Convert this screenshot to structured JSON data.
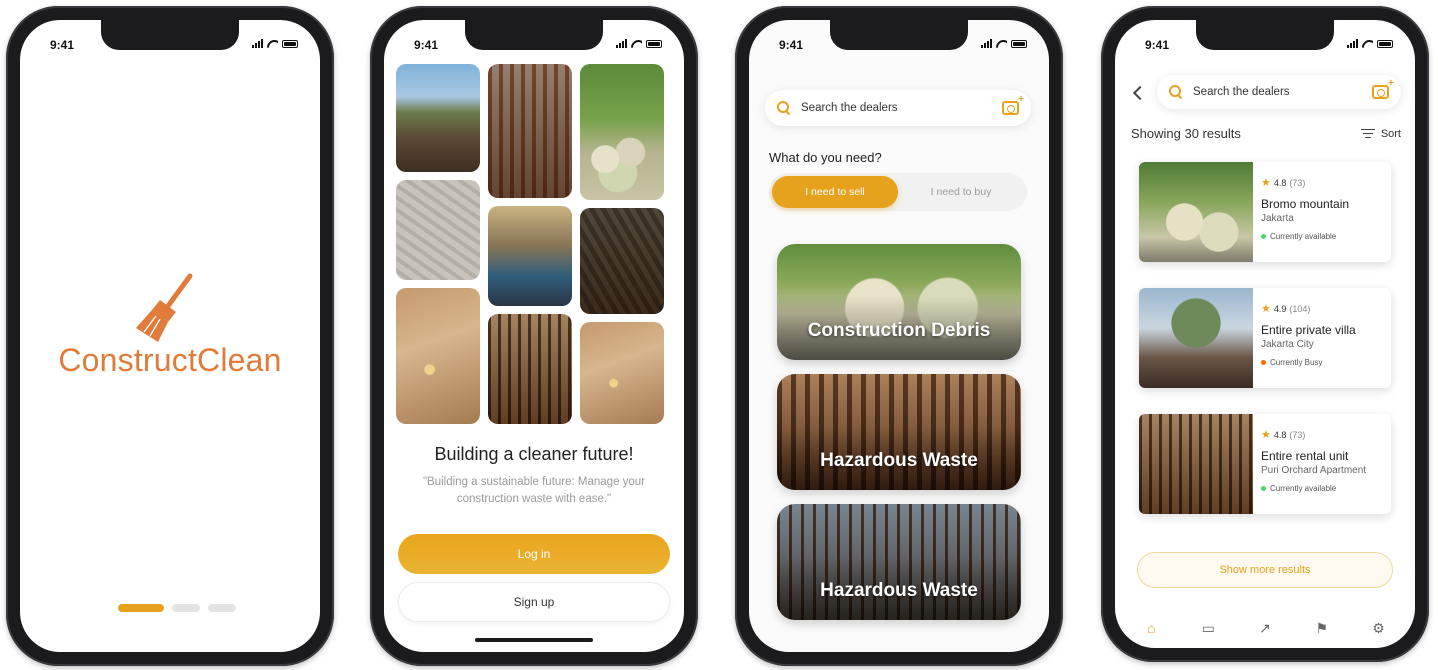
{
  "status_time": "9:41",
  "splash": {
    "brand": "ConstructClean"
  },
  "welcome": {
    "title": "Building a cleaner future!",
    "subtitle": "\"Building a sustainable future: Manage your construction waste with ease.\"",
    "login_label": "Log in",
    "signup_label": "Sign up"
  },
  "home": {
    "search_placeholder": "Search the dealers",
    "need_label": "What do you need?",
    "segments": [
      "I need to sell",
      "I need to buy"
    ],
    "categories": [
      "Construction  Debris",
      "Hazardous Waste",
      "Hazardous Waste"
    ]
  },
  "results": {
    "search_placeholder": "Search the dealers",
    "count_label": "Showing 30 results",
    "sort_label": "Sort",
    "items": [
      {
        "score": "4.8",
        "reviews": "(73)",
        "title": "Bromo mountain",
        "location": "Jakarta",
        "status": "Currently available",
        "status_color": "#4cd964"
      },
      {
        "score": "4.9",
        "reviews": "(104)",
        "title": "Entire private villa",
        "location": "Jakarta City",
        "status": "Currently Busy",
        "status_color": "#ff6a00"
      },
      {
        "score": "4.8",
        "reviews": "(73)",
        "title": "Entire rental unit",
        "location": "Puri Orchard Apartment",
        "status": "Currently available",
        "status_color": "#4cd964"
      }
    ],
    "more_label": "Show more results",
    "tabs": [
      "home-icon",
      "calendar-icon",
      "trending-icon",
      "flag-icon",
      "settings-icon"
    ]
  },
  "colors": {
    "accent": "#e6a21c",
    "brand": "#e07b39"
  }
}
